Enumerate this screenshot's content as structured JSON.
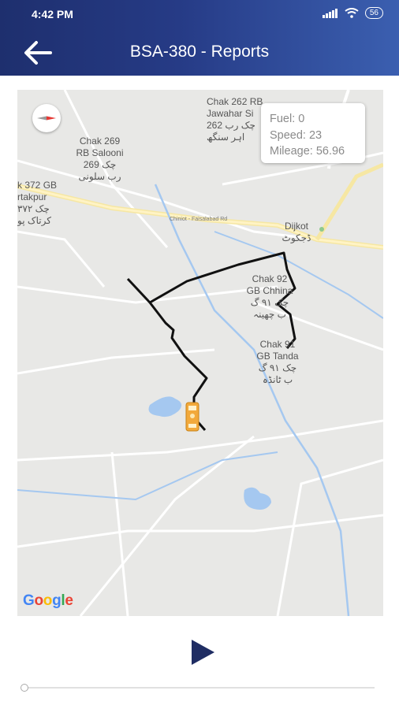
{
  "status": {
    "time": "4:42 PM",
    "battery": "56"
  },
  "header": {
    "title": "BSA-380 - Reports"
  },
  "info": {
    "fuel": "Fuel: 0",
    "speed": "Speed: 23",
    "mileage": "Mileage: 56.96"
  },
  "map": {
    "labels": {
      "chak262": "Chak 262 RB\nJawahar Si\n262 چک رب\nاہر سنگھ",
      "chak269": "Chak 269\nRB Salooni\n269 چک\nرب سلونی",
      "chak372": "k 372 GB\nrtakpur\nچک ۳۷۲\nکرتاک پو",
      "road": "Chiniot - Faisalabad Rd",
      "dijkot": "Dijkot\nڈجکوٹ",
      "chak92": "Chak 92\nGB Chhina\nچک ۹۱ گ\nب چھینہ",
      "chak91": "Chak 91\nGB Tanda\nچک ۹۱ گ\nب ٹانڈہ"
    },
    "attribution": "Google"
  },
  "controls": {
    "play_icon": "play-icon",
    "progress": 0
  }
}
